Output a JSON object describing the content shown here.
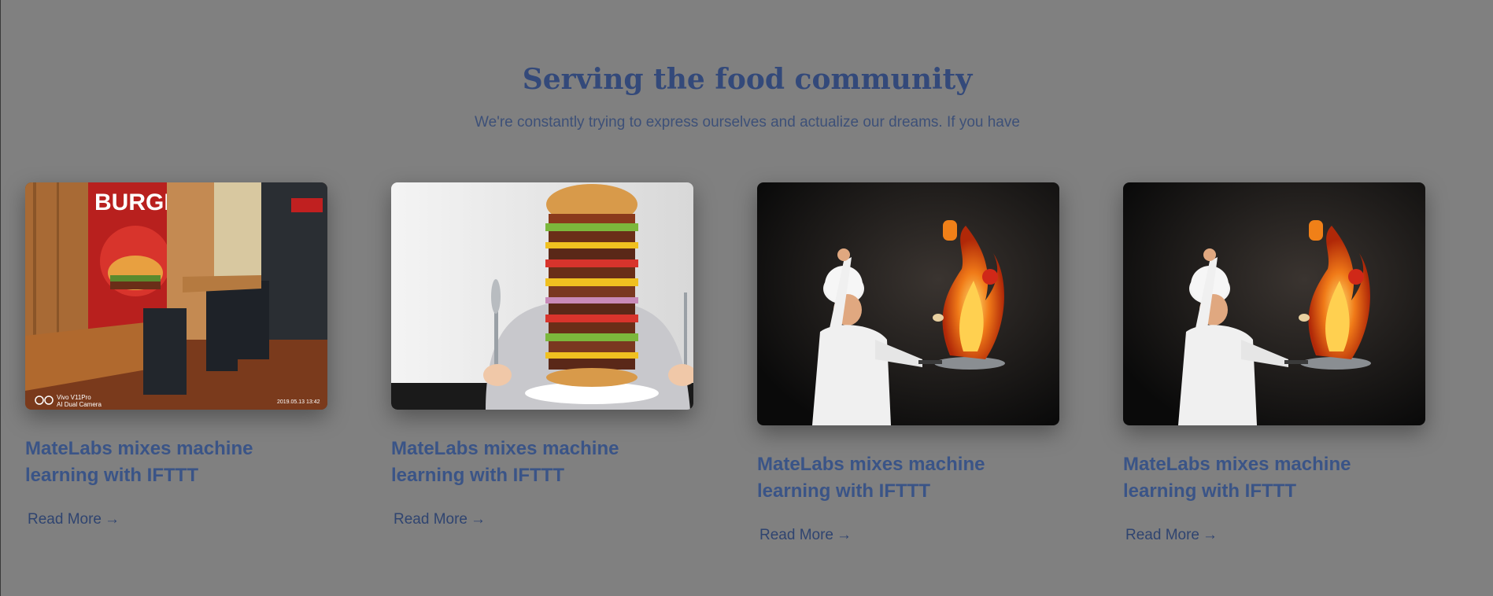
{
  "section": {
    "title": "Serving the food community",
    "subtitle": "We're constantly trying to express ourselves and actualize our dreams. If you have"
  },
  "cards": [
    {
      "title": "MateLabs mixes machine learning with IFTTT",
      "read_more": "Read More",
      "image": "burger-restaurant-interior",
      "image_text": {
        "sign": "BURGER",
        "camera_model": "Vivo V11Pro",
        "camera_mode": "AI Dual Camera",
        "timestamp": "2019.05.13 13:42"
      }
    },
    {
      "title": "MateLabs mixes machine learning with IFTTT",
      "read_more": "Read More",
      "image": "giant-stacked-burger"
    },
    {
      "title": "MateLabs mixes machine learning with IFTTT",
      "read_more": "Read More",
      "image": "chef-flaming-pan"
    },
    {
      "title": "MateLabs mixes machine learning with IFTTT",
      "read_more": "Read More",
      "image": "chef-flaming-pan"
    }
  ],
  "icons": {
    "read_more": "arrow-right-icon"
  },
  "colors": {
    "background": "#808080",
    "heading": "#33497a",
    "card_title": "#3a5487",
    "link": "#2f4470"
  }
}
